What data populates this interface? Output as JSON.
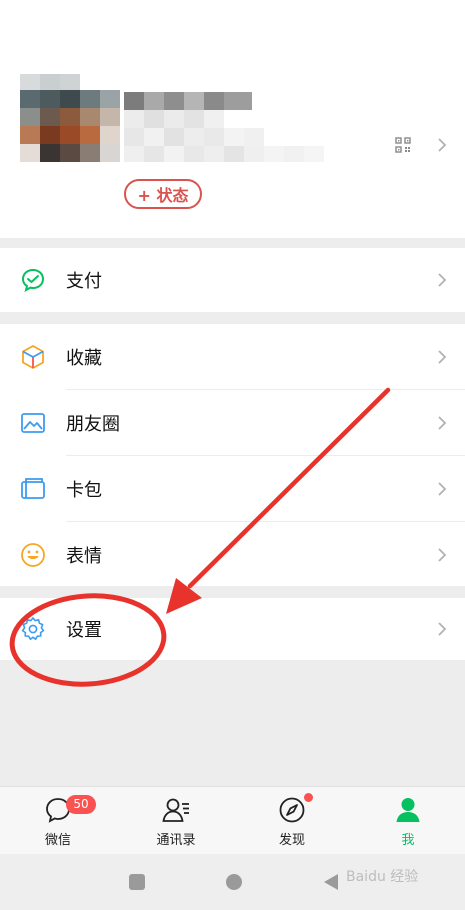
{
  "profile": {
    "status_button": "+ 状态",
    "icons": [
      "qrcode-icon",
      "chevron-right-icon"
    ]
  },
  "menu": {
    "pay": {
      "label": "支付",
      "icon": "wechat-pay-icon"
    },
    "services": [
      {
        "label": "收藏",
        "icon": "favorites-cube-icon"
      },
      {
        "label": "朋友圈",
        "icon": "moments-picture-icon"
      },
      {
        "label": "卡包",
        "icon": "card-wallet-icon"
      },
      {
        "label": "表情",
        "icon": "sticker-smile-icon"
      }
    ],
    "settings": {
      "label": "设置",
      "icon": "gear-icon"
    }
  },
  "tabbar": {
    "tabs": [
      {
        "label": "微信",
        "icon": "chat-bubble-icon",
        "badge": "50"
      },
      {
        "label": "通讯录",
        "icon": "contacts-icon"
      },
      {
        "label": "发现",
        "icon": "compass-icon"
      },
      {
        "label": "我",
        "icon": "person-icon",
        "active": true
      }
    ]
  },
  "watermark": "Baidu 经验",
  "colors": {
    "accent_green": "#07c160",
    "badge_red": "#fa5151",
    "annotation_red": "#e8322c",
    "background": "#ededed"
  }
}
